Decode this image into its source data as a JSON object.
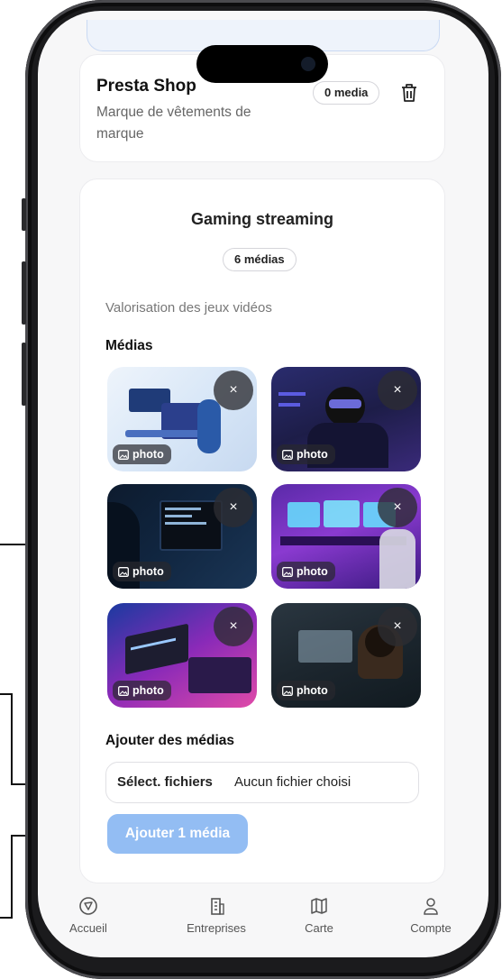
{
  "company": {
    "name": "Presta Shop",
    "description": "Marque de vêtements de marque",
    "media_count": "0 media",
    "delete_icon": "trash-icon"
  },
  "project": {
    "title": "Gaming streaming",
    "media_count": "6 médias",
    "description": "Valorisation des jeux vidéos",
    "medias_label": "Médias",
    "media": [
      {
        "label": "photo",
        "remove": "×",
        "icon": "image-icon"
      },
      {
        "label": "photo",
        "remove": "×",
        "icon": "image-icon"
      },
      {
        "label": "photo",
        "remove": "×",
        "icon": "image-icon"
      },
      {
        "label": "photo",
        "remove": "×",
        "icon": "image-icon"
      },
      {
        "label": "photo",
        "remove": "×",
        "icon": "image-icon"
      },
      {
        "label": "photo",
        "remove": "×",
        "icon": "image-icon"
      }
    ],
    "add_label": "Ajouter des médias",
    "file_button": "Sélect. fichiers",
    "file_status": "Aucun fichier choisi",
    "submit": "Ajouter 1 média"
  },
  "nav": {
    "items": [
      {
        "label": "Accueil",
        "icon": "compass-icon"
      },
      {
        "label": "Entreprises",
        "icon": "building-icon"
      },
      {
        "label": "Carte",
        "icon": "map-icon"
      },
      {
        "label": "Compte",
        "icon": "user-icon"
      }
    ]
  },
  "colors": {
    "accent": "#93bdf3",
    "annotation_bracket": "#e0191b",
    "annotation_arrow": "#111111"
  }
}
